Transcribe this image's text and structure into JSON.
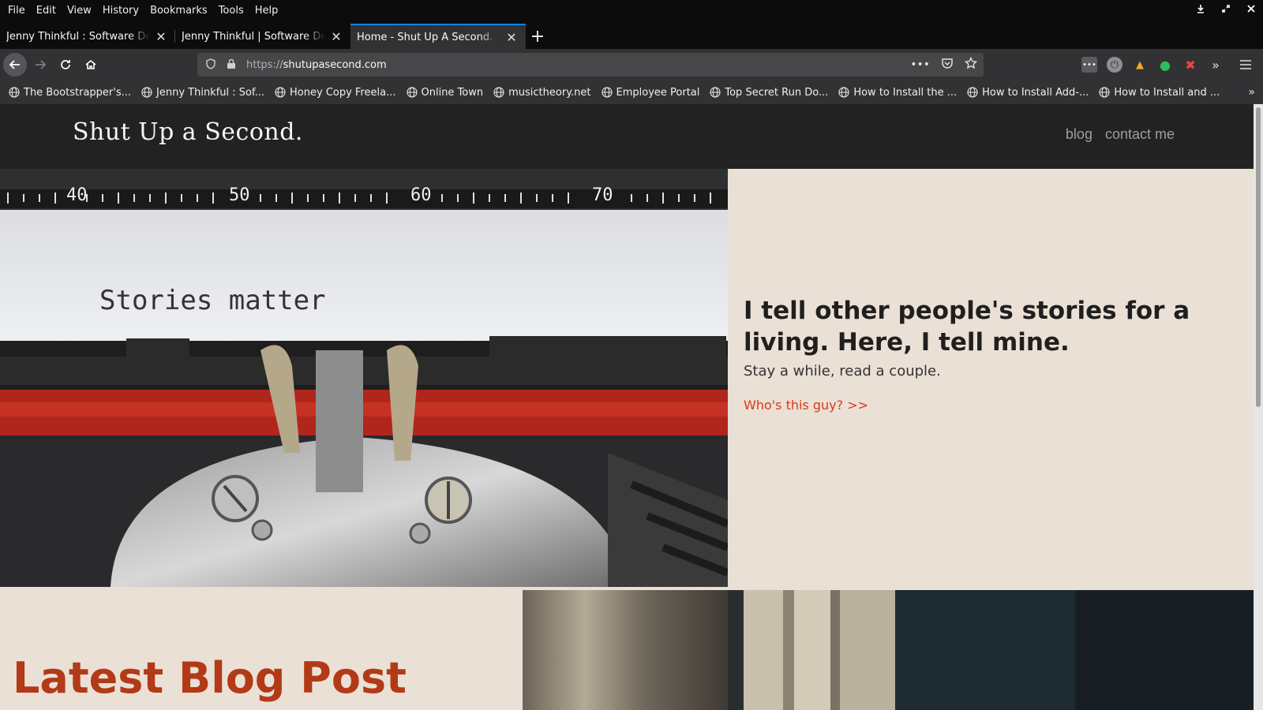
{
  "menubar": {
    "items": [
      "File",
      "Edit",
      "View",
      "History",
      "Bookmarks",
      "Tools",
      "Help"
    ]
  },
  "tabs": [
    {
      "title": "Jenny Thinkful : Software Developer",
      "active": false
    },
    {
      "title": "Jenny Thinkful | Software Developer",
      "active": false
    },
    {
      "title": "Home - Shut Up A Second.",
      "active": true
    }
  ],
  "navbar": {
    "url_protocol": "https://",
    "url_host": "shutupasecond.com",
    "page_actions_icon": "ellipsis-icon"
  },
  "bookmarks": [
    "The Bootstrapper's...",
    "Jenny Thinkful : Sof...",
    "Honey Copy Freela...",
    "Online Town",
    "musictheory.net",
    "Employee Portal",
    "Top Secret Run Do...",
    "How to Install the ...",
    "How to Install Add-...",
    "How to Install and ..."
  ],
  "site": {
    "logo": "Shut Up a Second.",
    "nav": [
      "blog",
      "contact me"
    ],
    "hero": {
      "image_text": "Stories matter",
      "heading": "I tell other people's stories for a living. Here, I tell mine.",
      "subheading": "Stay a while, read a couple.",
      "link": "Who's this guy? >>"
    },
    "latest_blog_title": "Latest Blog Post"
  },
  "colors": {
    "accent": "#d93a14",
    "blog_title": "#b23a16",
    "hero_bg": "#ebe0d6",
    "header_bg": "#222222",
    "tab_highlight": "#0a84ff"
  }
}
